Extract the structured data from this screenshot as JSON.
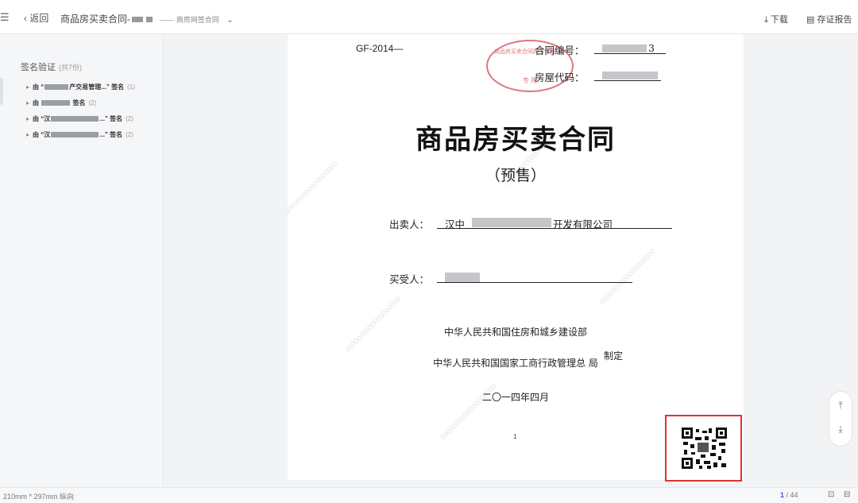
{
  "toolbar": {
    "menu_icon": "menu-icon",
    "back_label": "返回",
    "title": "商品房买卖合同-",
    "subtitle": "—— 商房网签合同",
    "download_label": "下载",
    "report_label": "存证报告"
  },
  "sidebar": {
    "title": "签名验证",
    "count": "(共7份)",
    "items": [
      {
        "prefix": "由",
        "text": "“",
        "suffix": "产交易管理...” 签名",
        "count": "(1)"
      },
      {
        "prefix": "由",
        "text": "",
        "suffix": "签名",
        "count": "(2)"
      },
      {
        "prefix": "由",
        "text": "“汉",
        "suffix": "...” 签名",
        "count": "(2)"
      },
      {
        "prefix": "由",
        "text": "“汉",
        "suffix": "...” 签名",
        "count": "(2)"
      }
    ]
  },
  "document": {
    "code": "GF-2014—",
    "contract_no_label": "合同编号：",
    "contract_no_tail": "3",
    "house_code_label": "房屋代码：",
    "seal_text_1": "商品房买卖合同网签专用",
    "seal_text_2": "专 用",
    "title": "商品房买卖合同",
    "subtitle": "（预售）",
    "seller_label": "出卖人：",
    "seller_value_head": "汉中",
    "seller_value_tail": "开发有限公司",
    "buyer_label": "买受人：",
    "issuer_1": "中华人民共和国住房和城乡建设部",
    "issuer_2": "中华人民共和国国家工商行政管理总  局",
    "issuer_suffix": "制定",
    "date": "二〇一四年四月",
    "page_number": "1"
  },
  "right_tools": {
    "up_icon": "scroll-top-icon",
    "down_icon": "scroll-bottom-icon"
  },
  "footer": {
    "paper_size": "210mm * 297mm 纵向",
    "current_page": "1",
    "total_pages": "/ 44"
  },
  "colors": {
    "accent": "#2a5bd7",
    "qr_frame": "#e03131",
    "seal": "#d54a5a"
  }
}
